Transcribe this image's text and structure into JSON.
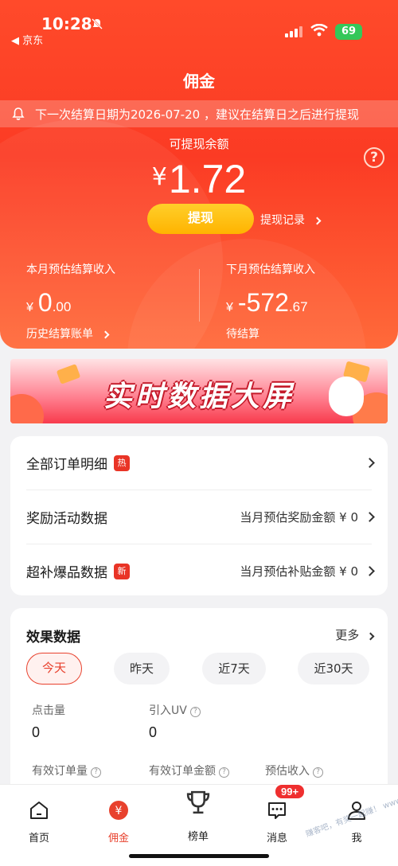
{
  "status_bar": {
    "time": "10:28",
    "back_app": "◀ 京东",
    "battery": "69"
  },
  "page": {
    "title": "佣金"
  },
  "notice": {
    "text": "下一次结算日期为2026-07-20 ，建议在结算日之后进行提现"
  },
  "balance": {
    "label": "可提现余额",
    "currency": "¥",
    "amount": "1.72",
    "help": "?"
  },
  "actions": {
    "withdraw": "提现",
    "withdraw_record": "提现记录"
  },
  "this_month": {
    "label": "本月预估结算收入",
    "currency": "¥",
    "int": "0",
    "dec": ".00",
    "link": "历史结算账单"
  },
  "next_month": {
    "label": "下月预估结算收入",
    "currency": "¥",
    "int": "-572",
    "dec": ".67",
    "status": "待结算"
  },
  "banner": {
    "title": "实时数据大屏"
  },
  "menu": [
    {
      "label": "全部订单明细",
      "tag": "热",
      "right": ""
    },
    {
      "label": "奖励活动数据",
      "tag": "",
      "right": "当月预估奖励金额 ¥ 0"
    },
    {
      "label": "超补爆品数据",
      "tag": "新",
      "right": "当月预估补贴金额 ¥ 0"
    }
  ],
  "effect": {
    "title": "效果数据",
    "more": "更多",
    "tabs": [
      "今天",
      "昨天",
      "近7天",
      "近30天"
    ],
    "active_tab": 0,
    "metrics": [
      {
        "label": "点击量",
        "value": "0"
      },
      {
        "label": "引入UV",
        "value": "0"
      },
      {
        "label": "有效订单量",
        "value": ""
      },
      {
        "label": "有效订单金额",
        "value": ""
      },
      {
        "label": "预估收入",
        "value": ""
      }
    ]
  },
  "tabbar": {
    "items": [
      "首页",
      "佣金",
      "榜单",
      "消息",
      "我"
    ],
    "active": 1,
    "message_badge": "99+"
  },
  "watermark": "赚客吧，有奖一起赚！  www.zuanke8.com",
  "colors": {
    "accent": "#e8412d",
    "hero": "#fb3b24",
    "button": "#ffc107"
  }
}
